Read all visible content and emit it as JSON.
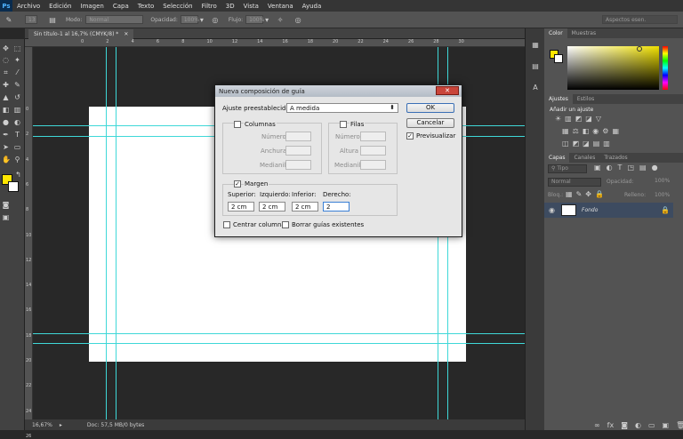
{
  "app": {
    "logo": "Ps"
  },
  "menu": [
    "Archivo",
    "Edición",
    "Imagen",
    "Capa",
    "Texto",
    "Selección",
    "Filtro",
    "3D",
    "Vista",
    "Ventana",
    "Ayuda"
  ],
  "options": {
    "mode_label": "Modo:",
    "mode_value": "Normal",
    "opacity_label": "Opacidad:",
    "opacity_value": "100%",
    "flow_label": "Flujo:",
    "flow_value": "100%",
    "brush_size": "13",
    "workspace": "Aspectos esen."
  },
  "document": {
    "tab_title": "Sin título-1 al 16,7% (CMYK/8) *",
    "zoom": "16,67%",
    "doc_info": "Doc: 57,5 MB/0 bytes"
  },
  "ruler_h": [
    "0",
    "2",
    "4",
    "6",
    "8",
    "10",
    "12",
    "14",
    "16",
    "18",
    "20",
    "22",
    "24",
    "26",
    "28",
    "30"
  ],
  "ruler_v": [
    "0",
    "2",
    "4",
    "6",
    "8",
    "10",
    "12",
    "14",
    "16",
    "18",
    "20",
    "22",
    "24",
    "26"
  ],
  "panels": {
    "color_tabs": [
      "Color",
      "Muestras"
    ],
    "adjust_tabs": [
      "Ajustes",
      "Estilos"
    ],
    "adjust_title": "Añadir un ajuste",
    "layer_tabs": [
      "Capas",
      "Canales",
      "Trazados"
    ],
    "kind": "Tipo",
    "blend": "Normal",
    "opacity_label": "Opacidad:",
    "opacity_value": "100%",
    "lock_label": "Bloq.:",
    "fill_label": "Relleno:",
    "fill_value": "100%",
    "layer_name": "Fondo"
  },
  "dialog": {
    "title": "Nueva composición de guía",
    "close": "✕",
    "preset_label": "Ajuste preestablecido:",
    "preset_value": "A medida",
    "columns": "Columnas",
    "rows": "Filas",
    "number": "Número",
    "width": "Anchura",
    "height": "Altura",
    "gutter": "Medianil",
    "margin": "Margen",
    "top_label": "Superior:",
    "left_label": "Izquierdo:",
    "bottom_label": "Inferior:",
    "right_label": "Derecho:",
    "top": "2 cm",
    "left": "2 cm",
    "bottom": "2 cm",
    "right": "2",
    "center_cols": "Centrar columnas",
    "clear_guides": "Borrar guías existentes",
    "ok": "OK",
    "cancel": "Cancelar",
    "preview": "Previsualizar"
  },
  "colors": {
    "foreground": "#ffe600",
    "background": "#ffffff",
    "guide": "#3fd8d8",
    "picker_hue": "#f0e000"
  }
}
